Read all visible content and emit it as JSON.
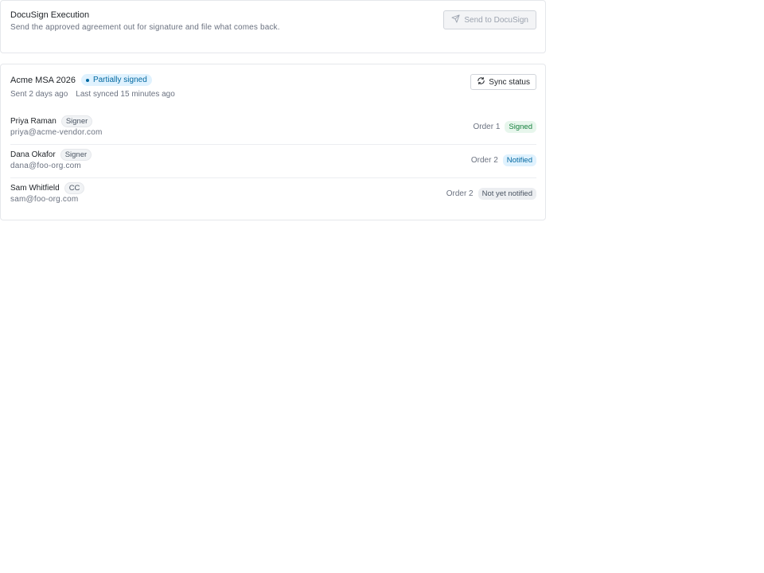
{
  "header": {
    "title": "DocuSign Execution",
    "subtitle": "Send the approved agreement out for signature and file what comes back.",
    "send_button_label": "Send to DocuSign",
    "send_button_icon": "send-icon",
    "send_button_disabled": true
  },
  "envelope": {
    "title": "Acme MSA 2026",
    "status": "Partially signed",
    "sent": "Sent 2 days ago",
    "last_synced": "Last synced 15 minutes ago",
    "sync_button_label": "Sync status",
    "sync_button_icon": "refresh-icon",
    "colors": {
      "partial": "#0369a1",
      "signed": "#15803d",
      "neutral": "#4b5563"
    }
  },
  "recipients": [
    {
      "name": "Priya Raman",
      "role": "Signer",
      "email": "priya@acme-vendor.com",
      "order": "Order 1",
      "state": "Signed",
      "state_kind": "signed"
    },
    {
      "name": "Dana Okafor",
      "role": "Signer",
      "email": "dana@foo-org.com",
      "order": "Order 2",
      "state": "Notified",
      "state_kind": "notified"
    },
    {
      "name": "Sam Whitfield",
      "role": "CC",
      "email": "sam@foo-org.com",
      "order": "Order 2",
      "state": "Not yet notified",
      "state_kind": "pending"
    }
  ]
}
